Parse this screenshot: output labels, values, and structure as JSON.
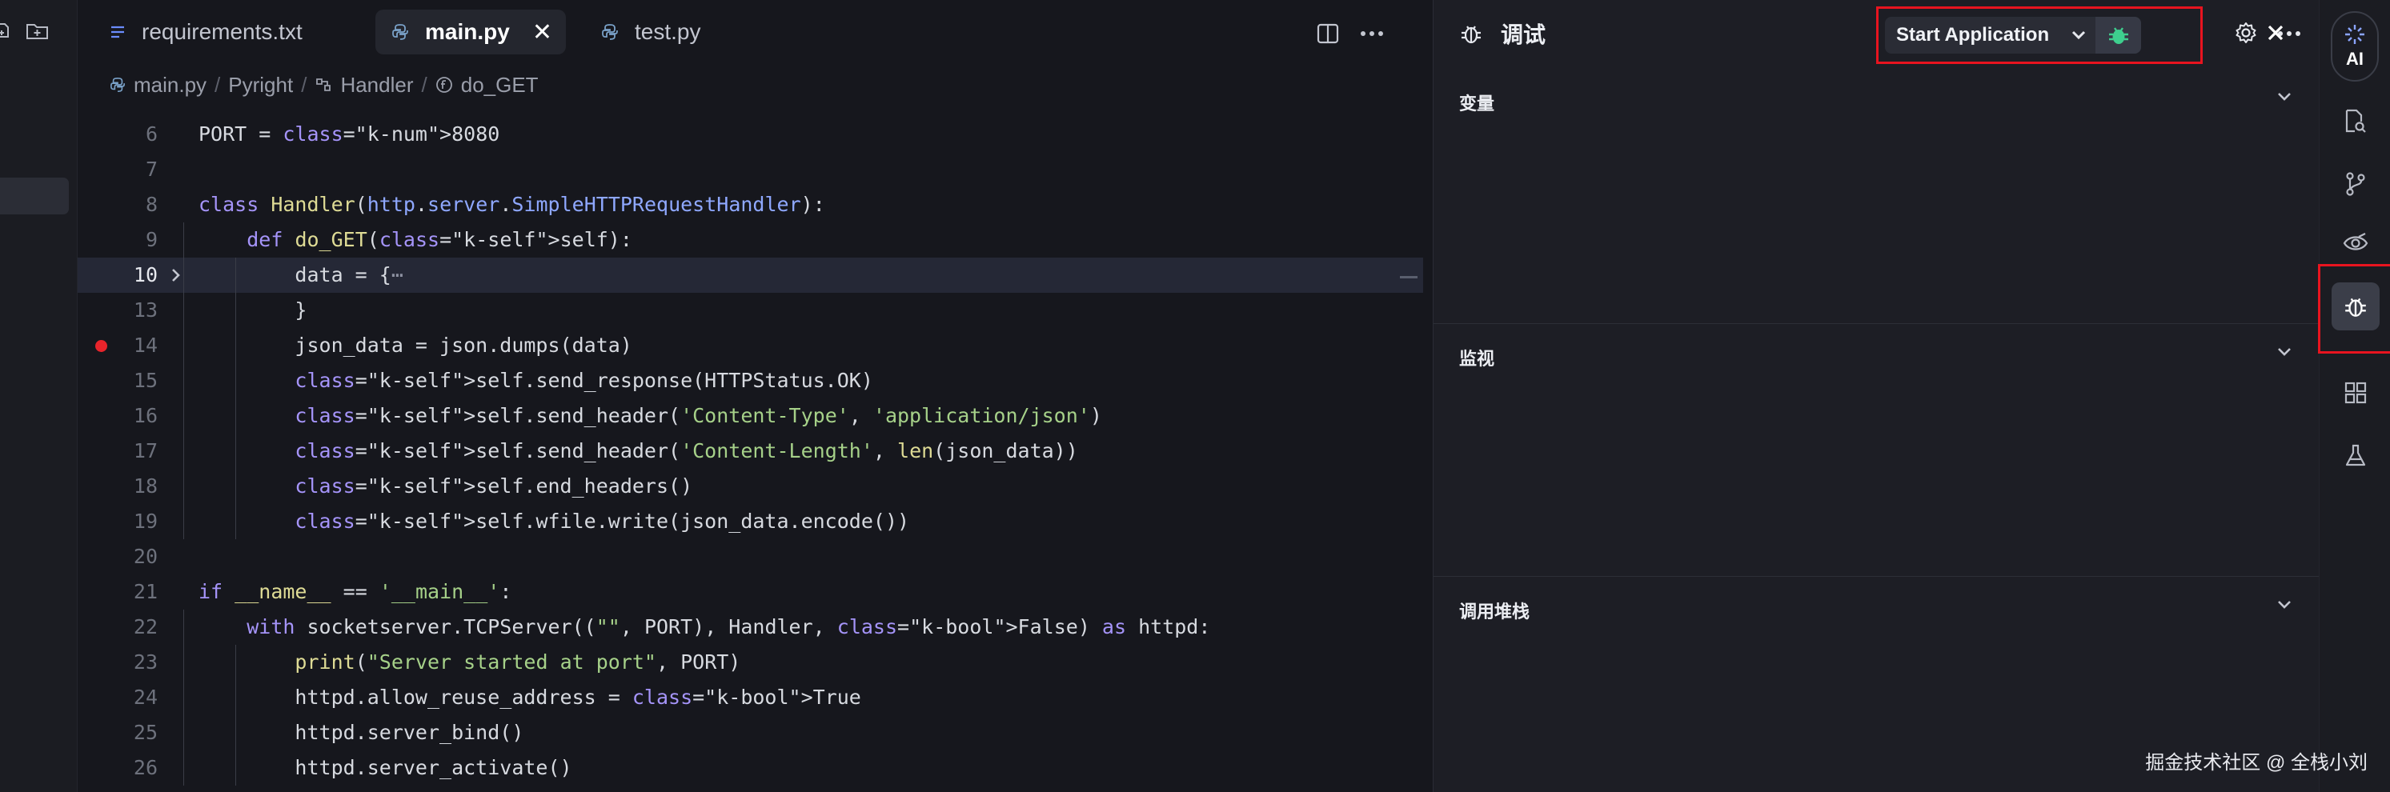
{
  "tabs": [
    {
      "label": "requirements.txt",
      "icon": "text-file-icon",
      "active": false
    },
    {
      "label": "main.py",
      "icon": "python-file-icon",
      "active": true
    },
    {
      "label": "test.py",
      "icon": "python-file-icon",
      "active": false
    }
  ],
  "breadcrumb": {
    "file": "main.py",
    "env": "Pyright",
    "class": "Handler",
    "method": "do_GET"
  },
  "code_lines": [
    {
      "num": "6",
      "text": "PORT = 8080"
    },
    {
      "num": "7",
      "text": ""
    },
    {
      "num": "8",
      "text": "class Handler(http.server.SimpleHTTPRequestHandler):"
    },
    {
      "num": "9",
      "text": "    def do_GET(self):"
    },
    {
      "num": "10",
      "text": "        data = {⋯",
      "current": true,
      "folded": true
    },
    {
      "num": "13",
      "text": "        }"
    },
    {
      "num": "14",
      "text": "        json_data = json.dumps(data)",
      "breakpoint": true
    },
    {
      "num": "15",
      "text": "        self.send_response(HTTPStatus.OK)"
    },
    {
      "num": "16",
      "text": "        self.send_header('Content-Type', 'application/json')"
    },
    {
      "num": "17",
      "text": "        self.send_header('Content-Length', len(json_data))"
    },
    {
      "num": "18",
      "text": "        self.end_headers()"
    },
    {
      "num": "19",
      "text": "        self.wfile.write(json_data.encode())"
    },
    {
      "num": "20",
      "text": ""
    },
    {
      "num": "21",
      "text": "if __name__ == '__main__':"
    },
    {
      "num": "22",
      "text": "    with socketserver.TCPServer((\"\", PORT), Handler, False) as httpd:"
    },
    {
      "num": "23",
      "text": "        print(\"Server started at port\", PORT)"
    },
    {
      "num": "24",
      "text": "        httpd.allow_reuse_address = True"
    },
    {
      "num": "25",
      "text": "        httpd.server_bind()"
    },
    {
      "num": "26",
      "text": "        httpd.server_activate()"
    }
  ],
  "debug_panel": {
    "title": "调试",
    "launch_config": "Start Application",
    "sections": [
      {
        "title": "变量"
      },
      {
        "title": "监视"
      },
      {
        "title": "调用堆栈"
      }
    ]
  },
  "activity_bar": {
    "ai_label": "AI",
    "items": [
      "search-file-icon",
      "source-control-icon",
      "eye-icon",
      "debug-icon",
      "extensions-icon",
      "flask-icon"
    ]
  },
  "watermark": "掘金技术社区 @ 全栈小刘",
  "colors": {
    "highlight_border": "#e8141f",
    "breakpoint": "#e8242b",
    "bug_accent": "#3ecf8e"
  }
}
